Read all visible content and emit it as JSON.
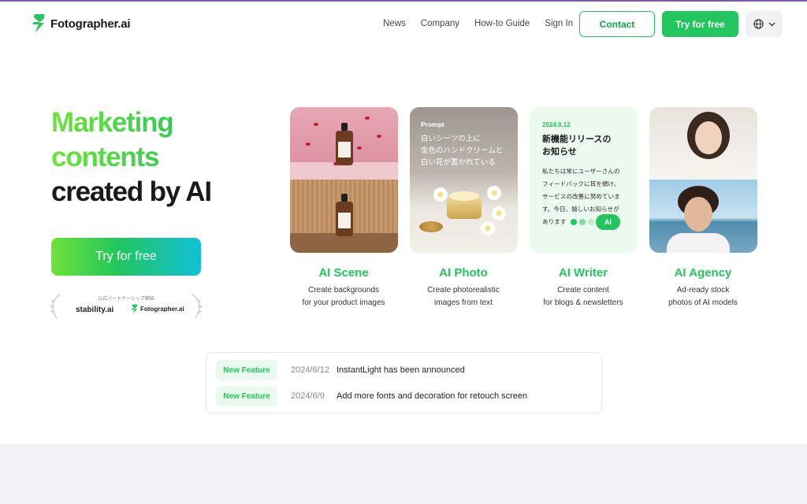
{
  "colors": {
    "brand_green": "#22c55e",
    "accent_purple": "#7b5ea7",
    "gradient_start": "#6ee33a",
    "gradient_end": "#12c0d8"
  },
  "header": {
    "logo_text": "Fotographer.ai",
    "logo_icon": "fotographer-logo-icon",
    "nav": [
      "News",
      "Company",
      "How-to Guide",
      "Sign In"
    ],
    "contact_label": "Contact",
    "try_label": "Try for free",
    "language_icon": "globe-icon"
  },
  "hero": {
    "title_line1": "Marketing",
    "title_line2": "contents",
    "title_line3": "created by AI",
    "cta_label": "Try for free",
    "partner_caption": "公式パートナーシップ締結",
    "partner_stability": "stability.ai",
    "partner_fotographer": "Fotographer.ai"
  },
  "features": [
    {
      "title": "AI Scene",
      "description": "Create backgrounds\nfor your product images"
    },
    {
      "title": "AI Photo",
      "description": "Create photorealistic\nimages from text"
    },
    {
      "title": "AI Writer",
      "description": "Create content\nfor blogs & newsletters"
    },
    {
      "title": "AI Agency",
      "description": "Ad-ready stock\nphotos of AI models"
    }
  ],
  "photo_card": {
    "prompt_label": "Prompt",
    "prompt_text": "白いシーツの上に\n金色のハンドクリームと\n白い花が置かれている"
  },
  "writer_card": {
    "date": "2024.8.12",
    "title": "新機能リリースの\nお知らせ",
    "body": "私たちは常にユーザーさんの\nフィードバックに耳を傾け、\nサービスの改善に努めていま\nす。今日、嬉しいお知らせが\nあります",
    "ai_badge": "AI"
  },
  "news": [
    {
      "badge": "New Feature",
      "date": "2024/6/12",
      "text": "InstantLight has been announced"
    },
    {
      "badge": "New Feature",
      "date": "2024/6/9",
      "text": "Add more fonts and decoration for retouch screen"
    }
  ]
}
